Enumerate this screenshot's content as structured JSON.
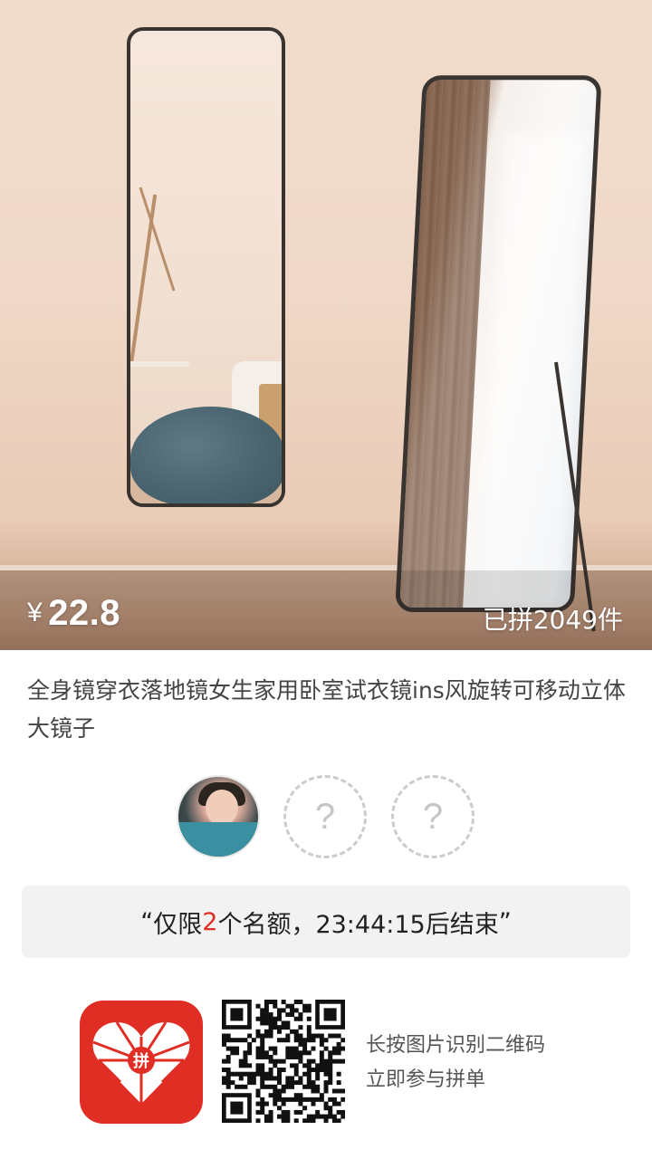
{
  "product": {
    "currency_symbol": "¥",
    "price": "22.8",
    "sold_count": "已拼2049件",
    "title": "全身镜穿衣落地镜女生家用卧室试衣镜ins风旋转可移动立体大镜子"
  },
  "group": {
    "slot_placeholder": "?",
    "banner": {
      "open_quote": "“",
      "prefix": "仅限",
      "count": "2",
      "suffix": "个名额，23:44:15后结束",
      "close_quote": "”"
    }
  },
  "footer": {
    "logo_char": "拼",
    "line1": "长按图片识别二维码",
    "line2": "立即参与拼单"
  },
  "colors": {
    "accent_red": "#e02e24",
    "banner_bg": "#f2f2f2"
  }
}
